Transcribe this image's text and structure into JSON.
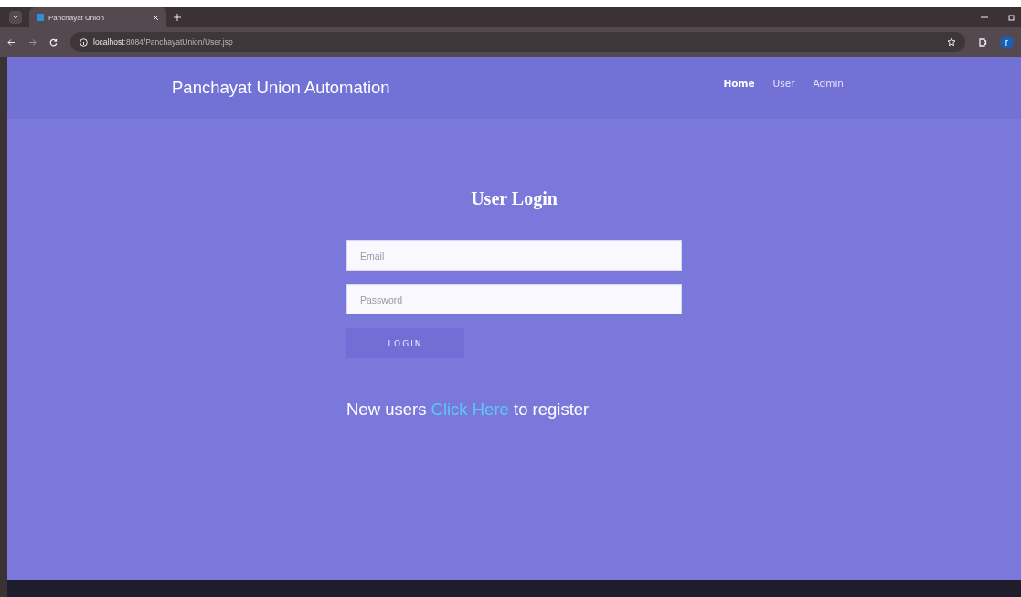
{
  "browser": {
    "tab_title": "Panchayat Union",
    "address_host": "localhost",
    "address_path": ":8084/PanchayatUnion/User.jsp",
    "profile_initial": "r"
  },
  "header": {
    "brand": "Panchayat Union Automation",
    "nav": [
      {
        "label": "Home",
        "selected": true
      },
      {
        "label": "User",
        "selected": false
      },
      {
        "label": "Admin",
        "selected": false
      }
    ]
  },
  "login": {
    "title": "User Login",
    "fields": [
      {
        "placeholder": "Email"
      },
      {
        "placeholder": "Password"
      }
    ],
    "button": "LOGIN"
  },
  "register": {
    "before": "New users",
    "link": "Click Here",
    "after": "to register"
  }
}
